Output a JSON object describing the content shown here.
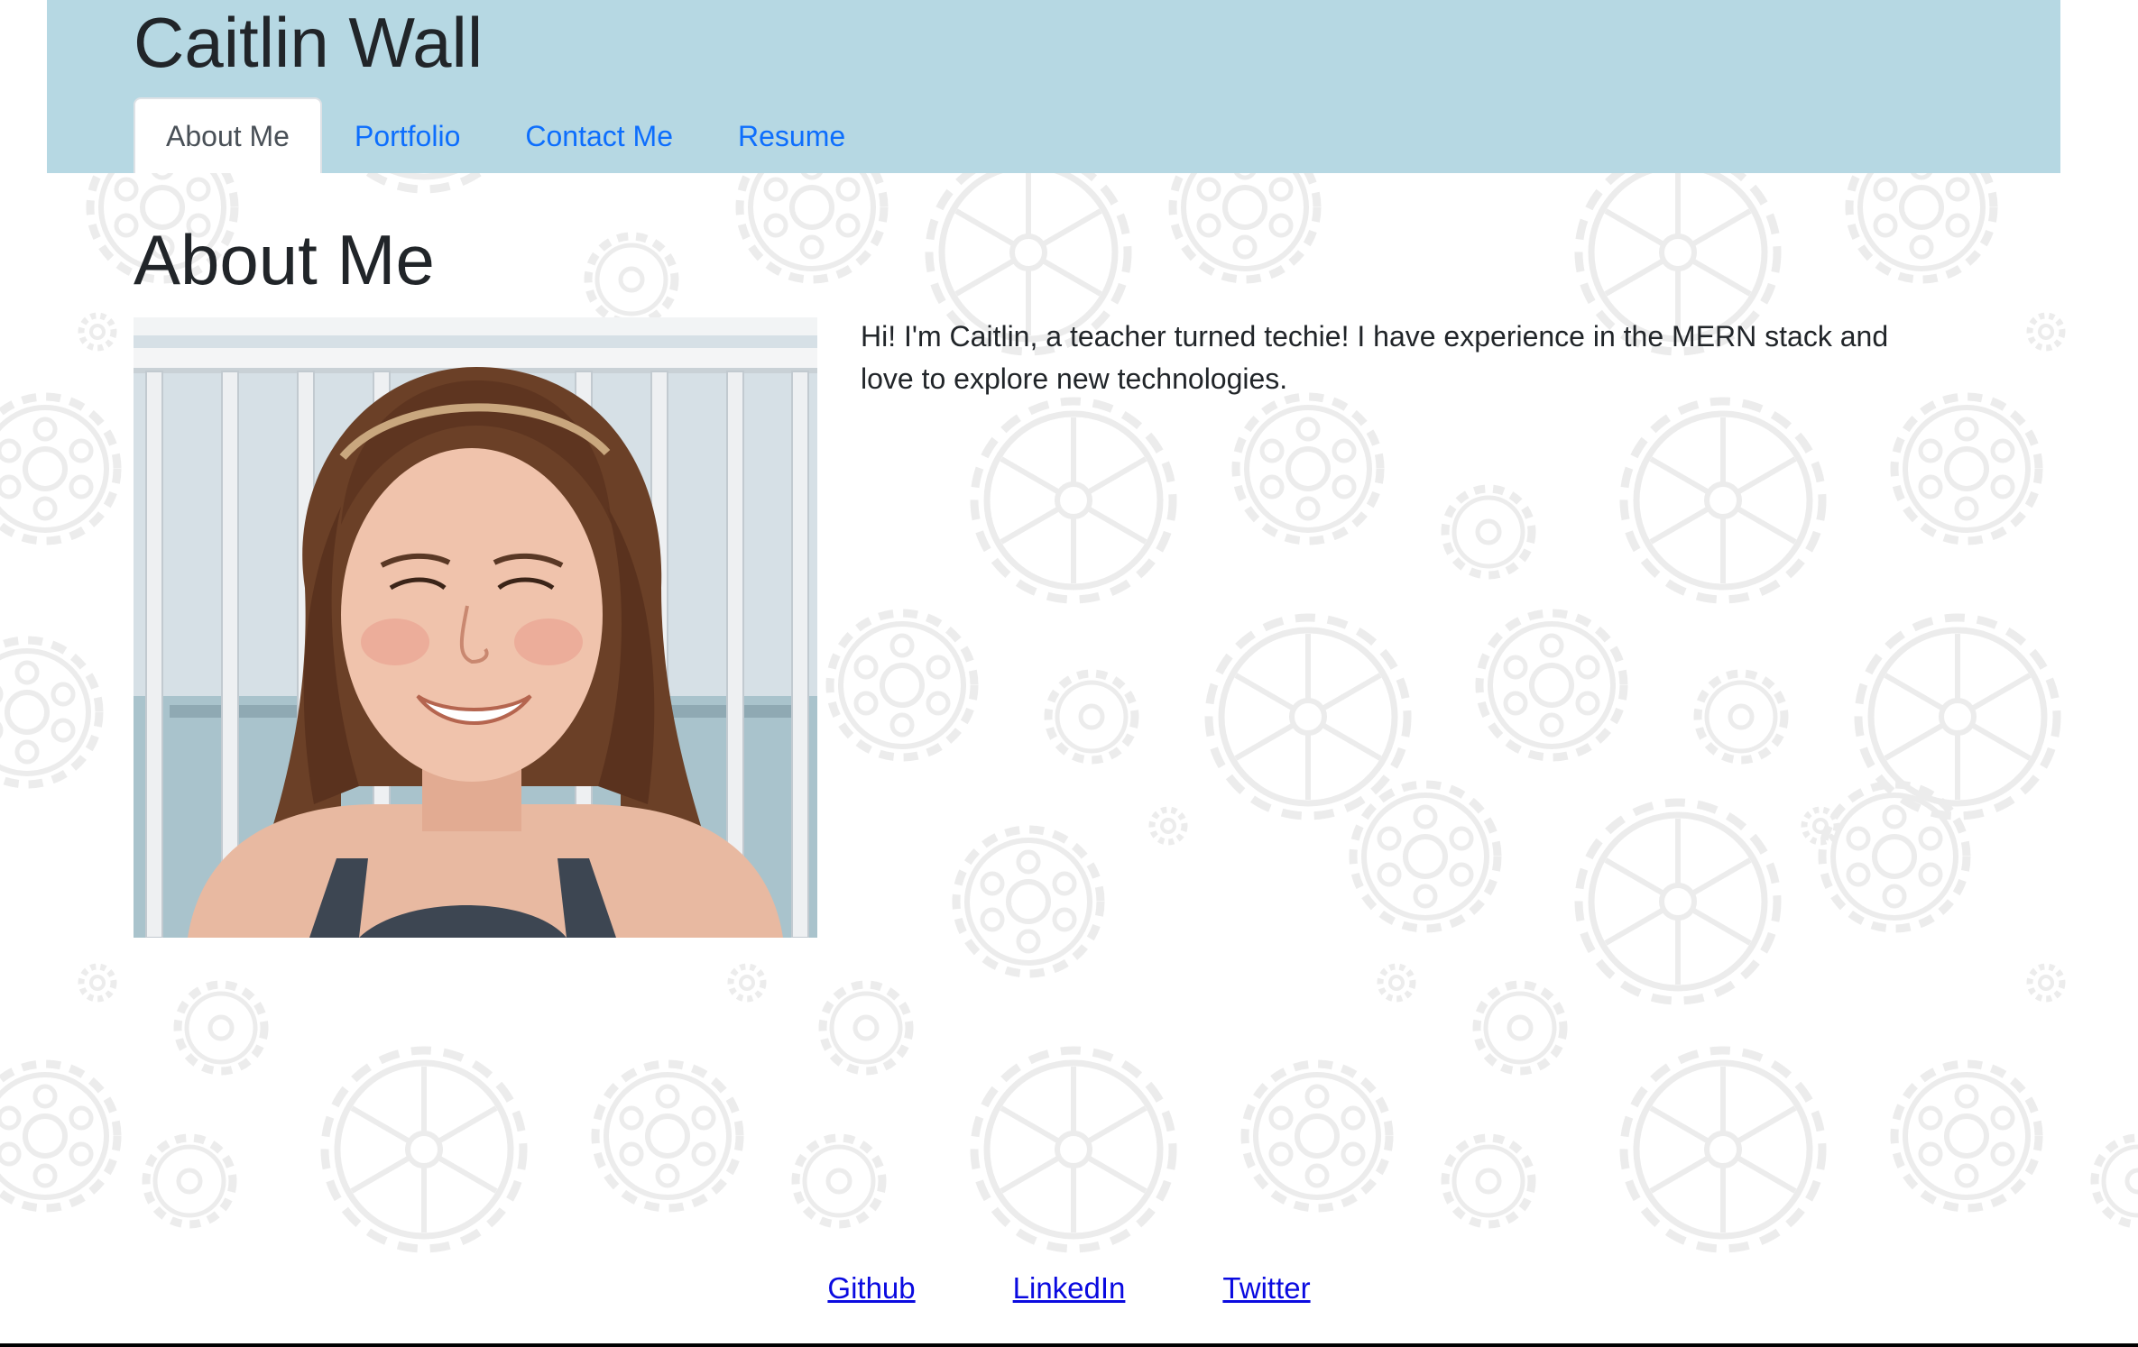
{
  "header": {
    "site_title": "Caitlin Wall",
    "background_color": "#b6d8e3",
    "tabs": [
      {
        "label": "About Me",
        "active": true
      },
      {
        "label": "Portfolio",
        "active": false
      },
      {
        "label": "Contact Me",
        "active": false
      },
      {
        "label": "Resume",
        "active": false
      }
    ]
  },
  "main": {
    "heading": "About Me",
    "photo_icon": "profile-photo",
    "bio": "Hi! I'm Caitlin, a teacher turned techie! I have experience in the MERN stack and love to explore new technologies."
  },
  "footer": {
    "links": [
      {
        "label": "Github"
      },
      {
        "label": "LinkedIn"
      },
      {
        "label": "Twitter"
      }
    ]
  },
  "colors": {
    "link": "#0d6efd",
    "footer_link": "#0a0ae0",
    "gear_pattern": "#ededed"
  }
}
